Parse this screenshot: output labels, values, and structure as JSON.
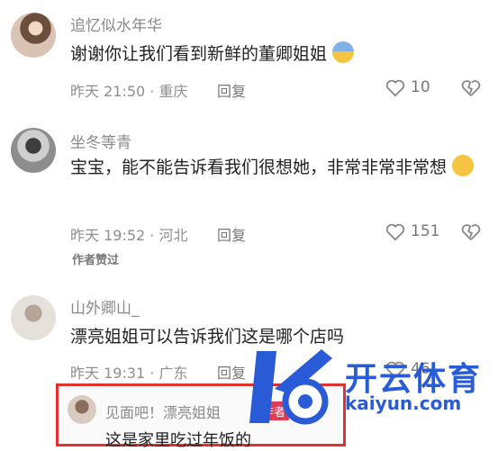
{
  "comments": [
    {
      "username": "追忆似水年华",
      "text": "谢谢你让我们看到新鲜的董卿姐姐",
      "emoji": "crying-face",
      "time": "昨天 21:50 · 重庆",
      "reply_label": "回复",
      "likes": "10"
    },
    {
      "username": "坐冬等青",
      "text": "宝宝，能不能告诉看我们很想她，非常非常非常想",
      "emoji": "pleading-face",
      "time": "昨天 19:52 · 河北",
      "reply_label": "回复",
      "likes": "151",
      "author_liked": "作者赞过"
    },
    {
      "username": "山外卿山_",
      "text": "漂亮姐姐可以告诉我们这是哪个店吗",
      "time": "昨天 19:31 · 广东",
      "reply_label": "回复",
      "likes": "46"
    }
  ],
  "reply": {
    "username": "见面吧！漂亮姐姐",
    "author_tag": "作者",
    "text": "这是家里吃过年饭的"
  },
  "watermark": {
    "cn": "开云体育",
    "en": "kaiyun.com"
  },
  "colors": {
    "highlight_border": "#e0332e",
    "watermark": "#2a5bd7",
    "author_tag": "#e03a55"
  }
}
